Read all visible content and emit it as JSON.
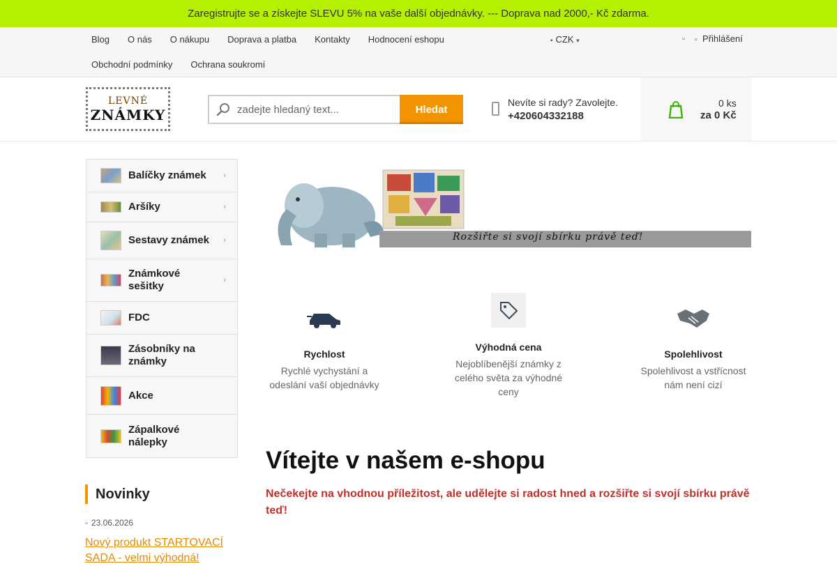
{
  "promo": {
    "text": "Zaregistrujte se a získejte SLEVU 5% na vaše další objednávky. --- Doprava nad 2000,- Kč zdarma.",
    "close_glyph": "",
    "color": "#b4f000"
  },
  "topnav": {
    "links": [
      "Blog",
      "O nás",
      "O nákupu",
      "Doprava a platba",
      "Kontakty",
      "Hodnocení eshopu",
      "Obchodní podmínky",
      "Ochrana soukromí"
    ],
    "currency": "CZK",
    "login_label": "Přihlášení"
  },
  "logo": {
    "line1": "LEVNÉ",
    "line2": "ZNÁMKY"
  },
  "search": {
    "placeholder": "zadejte hledaný text...",
    "button_label": "Hledat"
  },
  "contact": {
    "prompt": "Nevíte si rady? Zavolejte.",
    "phone": "+420604332188"
  },
  "cart": {
    "count": "0 ks",
    "total": "za 0 Kč"
  },
  "categories": [
    {
      "label": "Balíčky známek",
      "has_submenu": true
    },
    {
      "label": "Aršíky",
      "has_submenu": true
    },
    {
      "label": "Sestavy známek",
      "has_submenu": true
    },
    {
      "label": "Známkové sešitky",
      "has_submenu": true
    },
    {
      "label": "FDC",
      "has_submenu": false
    },
    {
      "label": "Zásobníky na známky",
      "has_submenu": false
    },
    {
      "label": "Akce",
      "has_submenu": false
    },
    {
      "label": "Zápalkové nálepky",
      "has_submenu": false
    }
  ],
  "news": {
    "heading": "Novinky",
    "date": "23.06.2026",
    "link_text": "Nový produkt STARTOVACÍ SADA - velmi výhodná!"
  },
  "banner": {
    "text": "Rozšiřte si svojí sbírku právě teď!"
  },
  "features": [
    {
      "title": "Rychlost",
      "desc": "Rychlé vychystání a odeslání vaší objednávky",
      "icon": "car-icon"
    },
    {
      "title": "Výhodná cena",
      "desc": "Nejoblíbenější známky z celého světa za výhodné ceny",
      "icon": "price-tag-icon"
    },
    {
      "title": "Spolehlivost",
      "desc": "Spolehlivost a vstřícnost nám není cizí",
      "icon": "handshake-icon"
    }
  ],
  "welcome": {
    "title": "Vítejte v našem e-shopu",
    "subtitle": "Nečekejte na vhodnou příležitost, ale udělejte si radost hned a rozšiřte si svojí sbírku právě teď!"
  },
  "colors": {
    "accent": "#f29400",
    "promo": "#b4f000",
    "highlight_text": "#c0302a"
  }
}
